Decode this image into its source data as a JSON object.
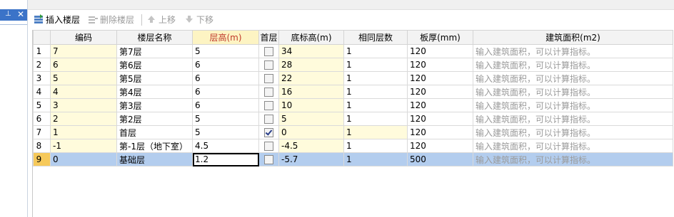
{
  "leftpane": {
    "pin_glyph": "⊥",
    "close_glyph": "✕"
  },
  "toolbar": {
    "insert_label": "插入楼层",
    "delete_label": "删除楼层",
    "up_label": "上移",
    "down_label": "下移"
  },
  "columns": [
    "",
    "编码",
    "楼层名称",
    "层高(m)",
    "首层",
    "底标高(m)",
    "相同层数",
    "板厚(mm)",
    "建筑面积(m2)"
  ],
  "rows": [
    {
      "n": "1",
      "code": "7",
      "name": "第7层",
      "h": "5",
      "first": false,
      "base": "34",
      "same": "1",
      "slab": "120",
      "area": "输入建筑面积，可以计算指标。"
    },
    {
      "n": "2",
      "code": "6",
      "name": "第6层",
      "h": "6",
      "first": false,
      "base": "28",
      "same": "1",
      "slab": "120",
      "area": "输入建筑面积，可以计算指标。"
    },
    {
      "n": "3",
      "code": "5",
      "name": "第5层",
      "h": "6",
      "first": false,
      "base": "22",
      "same": "1",
      "slab": "120",
      "area": "输入建筑面积，可以计算指标。"
    },
    {
      "n": "4",
      "code": "4",
      "name": "第4层",
      "h": "6",
      "first": false,
      "base": "16",
      "same": "1",
      "slab": "120",
      "area": "输入建筑面积，可以计算指标。"
    },
    {
      "n": "5",
      "code": "3",
      "name": "第3层",
      "h": "6",
      "first": false,
      "base": "10",
      "same": "1",
      "slab": "120",
      "area": "输入建筑面积，可以计算指标。"
    },
    {
      "n": "6",
      "code": "2",
      "name": "第2层",
      "h": "5",
      "first": false,
      "base": "5",
      "same": "1",
      "slab": "120",
      "area": "输入建筑面积，可以计算指标。"
    },
    {
      "n": "7",
      "code": "1",
      "name": "首层",
      "h": "5",
      "first": true,
      "base": "0",
      "same": "1",
      "slab": "120",
      "area": "输入建筑面积，可以计算指标。"
    },
    {
      "n": "8",
      "code": "-1",
      "name": "第-1层（地下室）",
      "h": "4.5",
      "first": false,
      "base": "-4.5",
      "same": "1",
      "slab": "120",
      "area": "输入建筑面积，可以计算指标。"
    },
    {
      "n": "9",
      "code": "0",
      "name": "基础层",
      "h": "1.2",
      "first": false,
      "base": "-5.7",
      "same": "1",
      "slab": "500",
      "area": "输入建筑面积，可以计算指标。"
    }
  ],
  "selected_row": 8
}
